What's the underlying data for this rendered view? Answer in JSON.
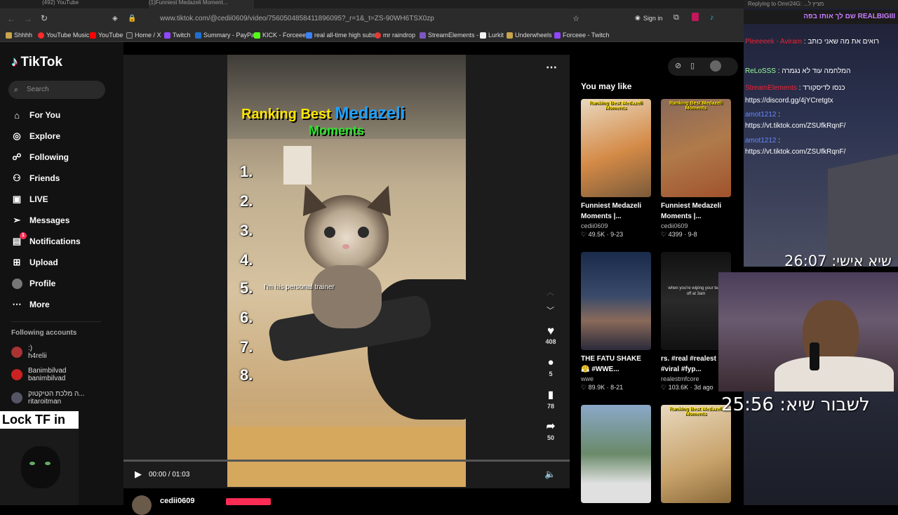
{
  "browser": {
    "tabs": [
      "(492) YouTube",
      "(1)Funniest Medazeli Moment..."
    ],
    "url": "www.tiktok.com/@cedii0609/video/7560504858411896095?_r=1&_t=ZS-90WH6TSX0zp",
    "sign_in": "Sign in",
    "bookmarks": [
      "Shhhh",
      "YouTube Music",
      "YouTube",
      "Home / X",
      "Twitch",
      "Summary - PayPal",
      "KICK - Forceee",
      "real all-time high subs",
      "mr raindrop",
      "StreamElements -",
      "Lurkit",
      "Underwheels",
      "Forceee - Twitch"
    ]
  },
  "sidebar": {
    "logo": "TikTok",
    "search_placeholder": "Search",
    "nav": [
      {
        "label": "For You",
        "icon": "home-icon"
      },
      {
        "label": "Explore",
        "icon": "compass-icon"
      },
      {
        "label": "Following",
        "icon": "following-icon"
      },
      {
        "label": "Friends",
        "icon": "friends-icon"
      },
      {
        "label": "LIVE",
        "icon": "live-icon"
      },
      {
        "label": "Messages",
        "icon": "messages-icon"
      },
      {
        "label": "Notifications",
        "icon": "notifications-icon",
        "badge": "1"
      },
      {
        "label": "Upload",
        "icon": "upload-icon"
      },
      {
        "label": "Profile",
        "icon": "profile-icon"
      },
      {
        "label": "More",
        "icon": "more-icon"
      }
    ],
    "following_header": "Following accounts",
    "following": [
      {
        "name": ":)",
        "handle": "h4relii"
      },
      {
        "name": "Banimbilvad",
        "handle": "banimbilvad"
      },
      {
        "name": "ה מלכת הטיקטוק...",
        "handle": "ritaroitman"
      }
    ]
  },
  "video": {
    "title_line1": "Ranking Best",
    "title_highlight": "Medazeli",
    "title_line2": "Moments",
    "ranks": [
      "1.",
      "2.",
      "3.",
      "4.",
      "5.",
      "6.",
      "7.",
      "8."
    ],
    "caption": "I'm his personal trainer",
    "time": "00:00 / 01:03",
    "progress": 0.0,
    "author": "cedii0609",
    "likes": "408",
    "comments": "5",
    "saves": "78",
    "shares": "50"
  },
  "recommendations": {
    "header": "You may like",
    "items": [
      {
        "title": "Funniest Medazeli Moments |...",
        "author": "cedii0609",
        "likes": "49.5K",
        "date": "9-23",
        "thumb_text": "Ranking Best Medazeli Moments"
      },
      {
        "title": "Funniest Medazeli Moments |...",
        "author": "cedii0609",
        "likes": "4399",
        "date": "9-8",
        "thumb_text": "Ranking Best Medazeli Moments"
      },
      {
        "title": "THE FATU SHAKE 😤 #WWE...",
        "author": "wwe",
        "likes": "89.9K",
        "date": "8-21",
        "thumb_text": ""
      },
      {
        "title": "rs. #real #realest #viral #fyp...",
        "author": "realestmfcore",
        "likes": "103.6K",
        "date": "3d ago",
        "thumb_text": "when you're wiping your tears off at 3am"
      },
      {
        "title": "",
        "author": "",
        "likes": "",
        "date": "",
        "thumb_text": ""
      },
      {
        "title": "",
        "author": "",
        "likes": "",
        "date": "",
        "thumb_text": "Ranking Best Medazeli Moments"
      }
    ]
  },
  "stream": {
    "reply_bar": "Replying to Omri24G: ...מציץ ל",
    "pinned": "שם לך אותו בפה REALBIGIII",
    "chat": [
      {
        "user": "Pleeeeek - Aviram",
        "msg": "רואים את מה שאני כותב"
      },
      {
        "user": "ReLoSSS",
        "msg": "המלחמה עוד לא נגמרה"
      },
      {
        "user": "StreamElements",
        "msg": "כנסו לדיסקורד"
      },
      {
        "user": "",
        "msg": "https://discord.gg/4jYCretgtx"
      },
      {
        "user": "amot1212",
        "msg": ""
      },
      {
        "user": "",
        "msg": "https://vt.tiktok.com/ZSUfkRqnF/"
      },
      {
        "user": "amot1212",
        "msg": ""
      },
      {
        "user": "",
        "msg": "https://vt.tiktok.com/ZSUfkRqnF/"
      }
    ],
    "timer_personal": "שיא אישי: 26:07",
    "timer_break": "לשבור שיא: 25:56",
    "overlay_text": "Lock TF in"
  },
  "colors": {
    "tiktok_red": "#fe2c55",
    "bg": "#000000",
    "sidebar": "#121212"
  }
}
